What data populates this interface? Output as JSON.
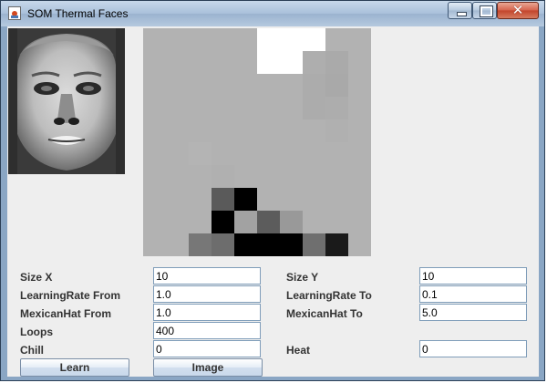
{
  "window": {
    "title": "SOM Thermal Faces",
    "app_icon": "java-cup-icon",
    "controls": [
      "minimize-icon",
      "maximize-icon",
      "close-icon"
    ],
    "close_glyph": "✕"
  },
  "face_image": {
    "description_icon": "thermal-face-image"
  },
  "som_map": {
    "rows": 10,
    "cols": 10,
    "default_color": "#b2b2b2",
    "cells": [
      {
        "row": 0,
        "col": 5,
        "color": "#ffffff"
      },
      {
        "row": 0,
        "col": 6,
        "color": "#ffffff"
      },
      {
        "row": 0,
        "col": 7,
        "color": "#ffffff"
      },
      {
        "row": 1,
        "col": 5,
        "color": "#ffffff"
      },
      {
        "row": 1,
        "col": 6,
        "color": "#ffffff"
      },
      {
        "row": 1,
        "col": 7,
        "color": "#aeaeae"
      },
      {
        "row": 1,
        "col": 8,
        "color": "#aaaaaa"
      },
      {
        "row": 2,
        "col": 7,
        "color": "#acacac"
      },
      {
        "row": 2,
        "col": 8,
        "color": "#a9a9a9"
      },
      {
        "row": 3,
        "col": 7,
        "color": "#acacac"
      },
      {
        "row": 3,
        "col": 8,
        "color": "#adadad"
      },
      {
        "row": 4,
        "col": 8,
        "color": "#b0b0b0"
      },
      {
        "row": 5,
        "col": 2,
        "color": "#b4b4b4"
      },
      {
        "row": 6,
        "col": 3,
        "color": "#b0b0b0"
      },
      {
        "row": 7,
        "col": 3,
        "color": "#5a5a5a"
      },
      {
        "row": 7,
        "col": 4,
        "color": "#000000"
      },
      {
        "row": 8,
        "col": 3,
        "color": "#000000"
      },
      {
        "row": 8,
        "col": 4,
        "color": "#a2a2a2"
      },
      {
        "row": 8,
        "col": 5,
        "color": "#5c5c5c"
      },
      {
        "row": 8,
        "col": 6,
        "color": "#999999"
      },
      {
        "row": 9,
        "col": 2,
        "color": "#777777"
      },
      {
        "row": 9,
        "col": 3,
        "color": "#6d6d6d"
      },
      {
        "row": 9,
        "col": 4,
        "color": "#000000"
      },
      {
        "row": 9,
        "col": 5,
        "color": "#000000"
      },
      {
        "row": 9,
        "col": 6,
        "color": "#000000"
      },
      {
        "row": 9,
        "col": 7,
        "color": "#6f6f6f"
      },
      {
        "row": 9,
        "col": 8,
        "color": "#1a1a1a"
      }
    ]
  },
  "form": {
    "size_x": {
      "label": "Size X",
      "value": "10"
    },
    "size_y": {
      "label": "Size Y",
      "value": "10"
    },
    "learning_rate_from": {
      "label": "LearningRate From",
      "value": "1.0"
    },
    "learning_rate_to": {
      "label": "LearningRate To",
      "value": "0.1"
    },
    "mexican_hat_from": {
      "label": "MexicanHat From",
      "value": "1.0"
    },
    "mexican_hat_to": {
      "label": "MexicanHat To",
      "value": "5.0"
    },
    "loops": {
      "label": "Loops",
      "value": "400"
    },
    "chill": {
      "label": "Chill",
      "value": "0"
    },
    "heat": {
      "label": "Heat",
      "value": "0"
    }
  },
  "buttons": {
    "learn": "Learn",
    "image": "Image"
  }
}
